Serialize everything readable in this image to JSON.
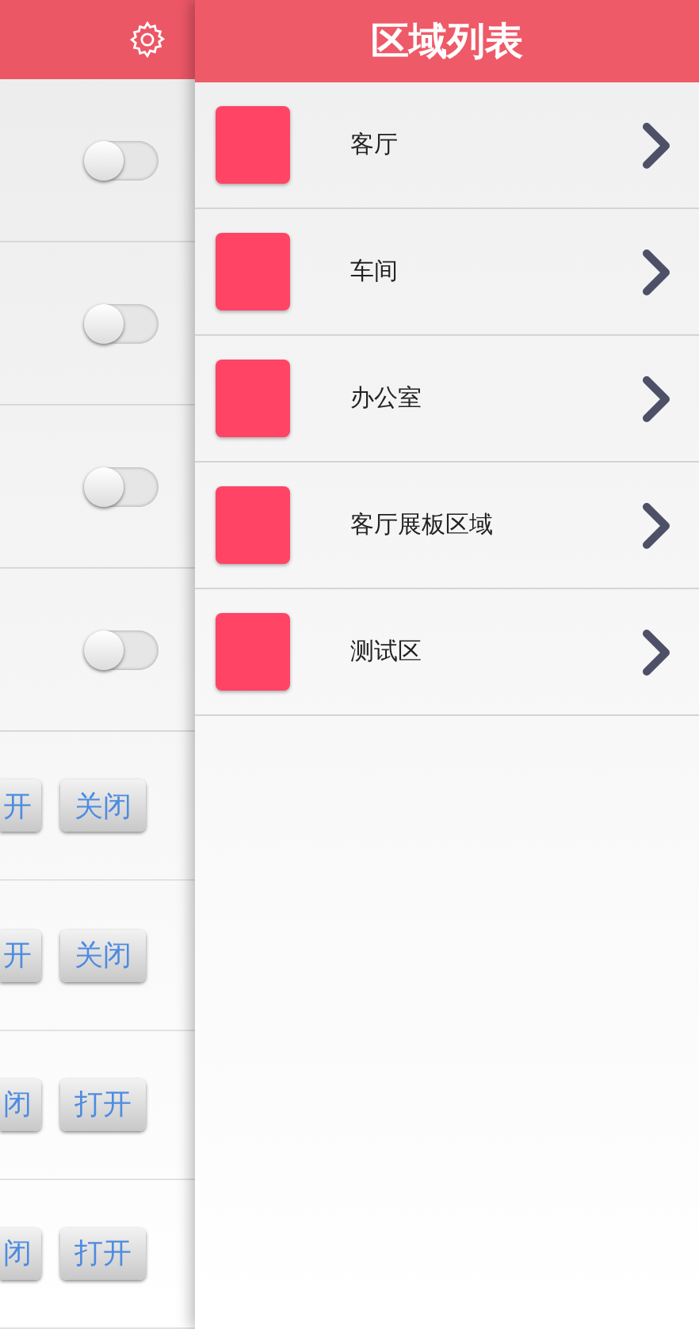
{
  "settings_panel": {
    "switch_rows": [
      {
        "on": false
      },
      {
        "on": false
      },
      {
        "on": false
      },
      {
        "on": false
      }
    ],
    "button_rows": [
      {
        "buttons": [
          "开",
          "关闭"
        ]
      },
      {
        "buttons": [
          "开",
          "关闭"
        ]
      },
      {
        "buttons": [
          "闭",
          "打开"
        ]
      },
      {
        "buttons": [
          "闭",
          "打开"
        ]
      }
    ]
  },
  "area_list": {
    "title": "区域列表",
    "items": [
      {
        "name": "客厅",
        "color": "#ff4466"
      },
      {
        "name": "车间",
        "color": "#ff4466"
      },
      {
        "name": "办公室",
        "color": "#ff4466"
      },
      {
        "name": "客厅展板区域",
        "color": "#ff4466"
      },
      {
        "name": "测试区",
        "color": "#ff4466"
      }
    ]
  }
}
